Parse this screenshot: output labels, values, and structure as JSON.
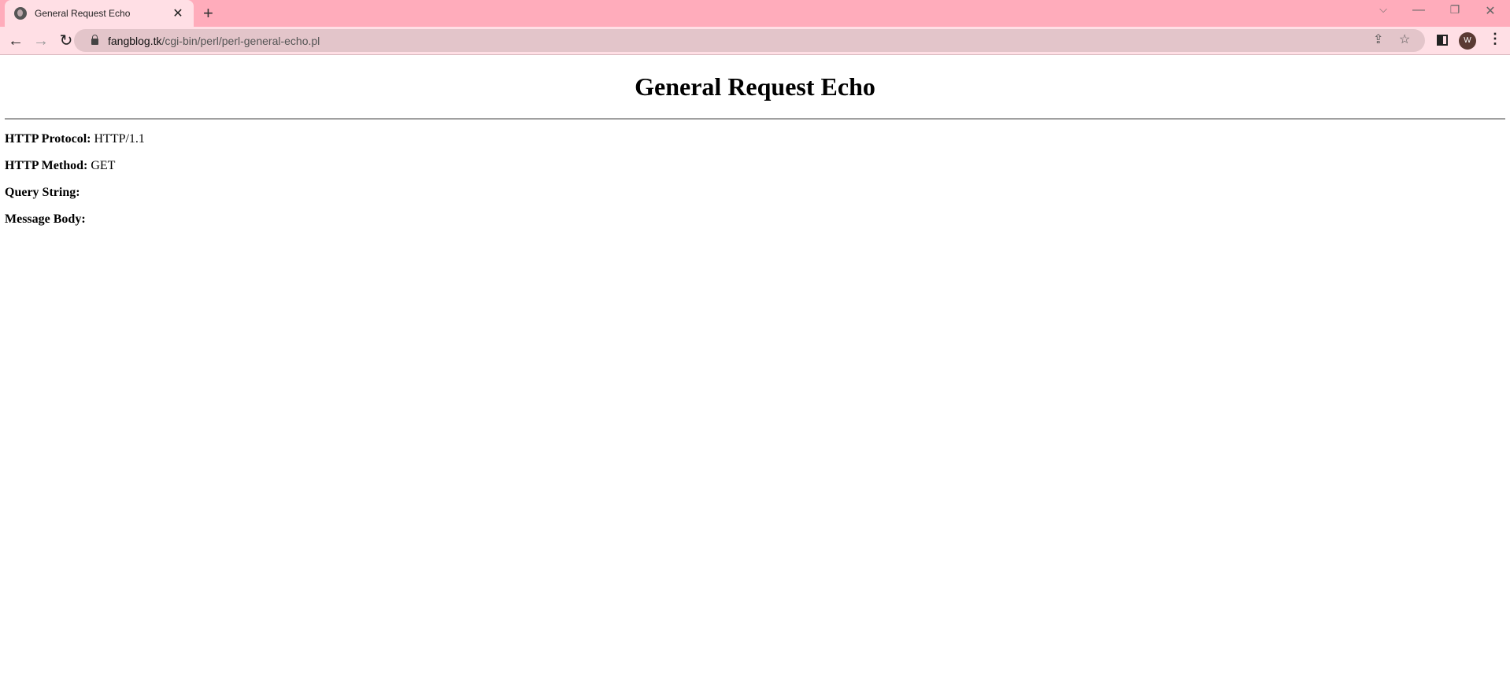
{
  "browser": {
    "tab": {
      "title": "General Request Echo",
      "icon": "globe-icon"
    },
    "url": {
      "host": "fangblog.tk",
      "path": "/cgi-bin/perl/perl-general-echo.pl"
    },
    "profile_initial": "W",
    "colors": {
      "tabstrip": "#ffacbb",
      "toolbar": "#ffdfe5",
      "omnibox": "#e3c5ca"
    }
  },
  "page": {
    "heading": "General Request Echo",
    "fields": [
      {
        "label": "HTTP Protocol:",
        "value": "HTTP/1.1"
      },
      {
        "label": "HTTP Method:",
        "value": "GET"
      },
      {
        "label": "Query String:",
        "value": ""
      },
      {
        "label": "Message Body:",
        "value": ""
      }
    ]
  }
}
